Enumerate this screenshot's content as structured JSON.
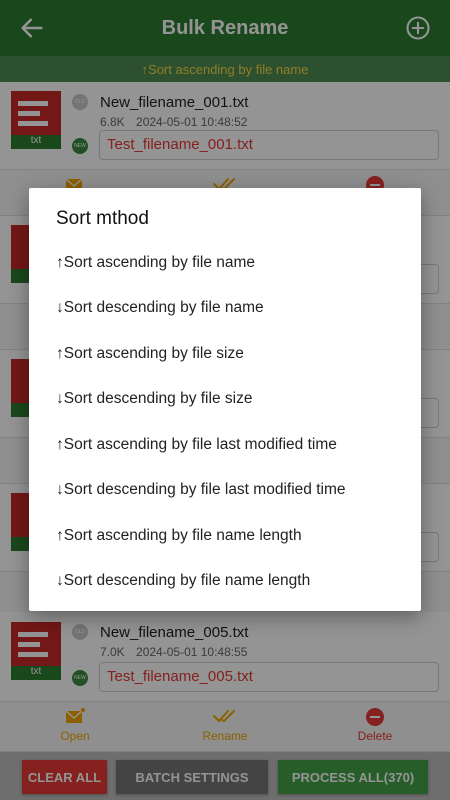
{
  "app_bar": {
    "title": "Bulk Rename",
    "back_icon": "arrow-left-icon",
    "add_icon": "plus-circle-icon"
  },
  "sort_indicator": "↑Sort ascending by file name",
  "files": [
    {
      "name": "New_filename_001.txt",
      "size": "6.8K",
      "modified": "2024-05-01 10:48:52",
      "new_name": "Test_filename_001.txt",
      "type_label": "txt"
    },
    {
      "name": "New_filename_005.txt",
      "size": "7.0K",
      "modified": "2024-05-01 10:48:55",
      "new_name": "Test_filename_005.txt",
      "type_label": "txt"
    }
  ],
  "actions": {
    "open": "Open",
    "rename": "Rename",
    "delete": "Delete"
  },
  "bottom_buttons": {
    "clear_all": "CLEAR ALL",
    "batch_settings": "BATCH SETTINGS",
    "process_all": "PROCESS ALL(370)"
  },
  "dialog": {
    "title": "Sort mthod",
    "options": [
      "↑Sort ascending by file name",
      "↓Sort descending by file name",
      "↑Sort ascending by file size",
      "↓Sort descending by file size",
      "↑Sort ascending by file last modified time",
      "↓Sort descending by file last modified time",
      "↑Sort ascending by file name length",
      "↓Sort descending by file name length"
    ]
  },
  "colors": {
    "app_bar": "#2e7d32",
    "sort_bar": "#4e8c52",
    "sort_text": "#f7d84a",
    "new_name_text": "#e53935",
    "action_label": "#f0a500",
    "delete_red": "#e53935",
    "clear_all": "#e53935",
    "batch_settings": "#757575",
    "process_all": "#43a047"
  }
}
